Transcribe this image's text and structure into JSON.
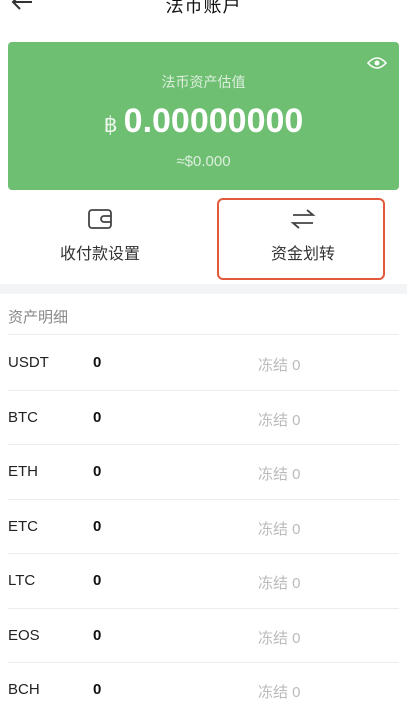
{
  "header": {
    "title": "法币账户"
  },
  "card": {
    "label": "法币资产估值",
    "currency_symbol": "฿",
    "amount": "0.00000000",
    "usd_estimate": "≈$0.000",
    "color": "#6fbf73"
  },
  "actions": [
    {
      "label": "收付款设置",
      "icon": "wallet-icon"
    },
    {
      "label": "资金划转",
      "icon": "transfer-icon"
    }
  ],
  "highlight_color": "#e25a3b",
  "section": {
    "title": "资产明细"
  },
  "assets": [
    {
      "coin": "USDT",
      "balance": "0",
      "frozen": "冻结 0"
    },
    {
      "coin": "BTC",
      "balance": "0",
      "frozen": "冻结 0"
    },
    {
      "coin": "ETH",
      "balance": "0",
      "frozen": "冻结 0"
    },
    {
      "coin": "ETC",
      "balance": "0",
      "frozen": "冻结 0"
    },
    {
      "coin": "LTC",
      "balance": "0",
      "frozen": "冻结 0"
    },
    {
      "coin": "EOS",
      "balance": "0",
      "frozen": "冻结 0"
    },
    {
      "coin": "BCH",
      "balance": "0",
      "frozen": "冻结 0"
    }
  ]
}
